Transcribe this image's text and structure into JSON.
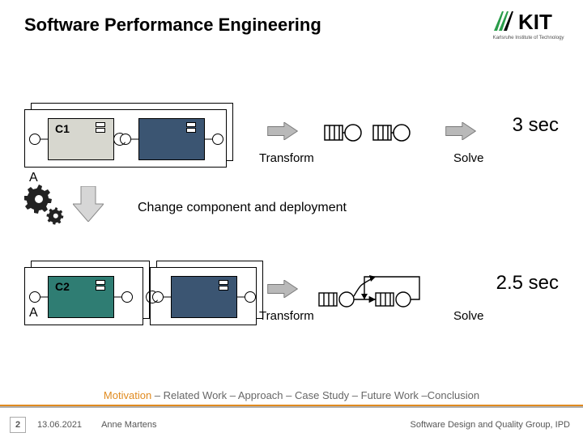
{
  "header": {
    "title": "Software Performance Engineering",
    "logo_caption": "Karlsruhe Institute of Technology",
    "logo_letters": "KIT"
  },
  "row1": {
    "node": "A",
    "comp1": "C1",
    "transform": "Transform",
    "solve": "Solve",
    "result": "3 sec"
  },
  "change": {
    "label": "Change component and deployment"
  },
  "row2": {
    "node": "A",
    "comp1": "C2",
    "transform": "Transform",
    "solve": "Solve",
    "result": "2.5 sec"
  },
  "breadcrumb": {
    "active": "Motivation",
    "rest": " – Related Work – Approach – Case Study – Future Work –Conclusion"
  },
  "footer": {
    "page": "2",
    "date": "13.06.2021",
    "author": "Anne Martens",
    "group": "Software Design and Quality Group, IPD"
  }
}
